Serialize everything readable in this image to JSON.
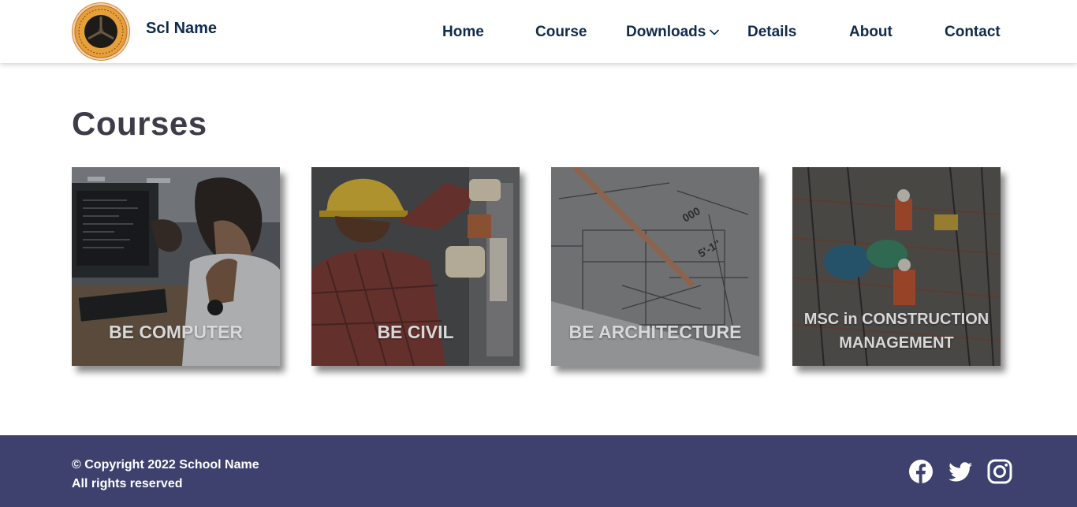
{
  "header": {
    "brand": "Scl Name",
    "logo_icon": "school-crest-logo",
    "nav": [
      {
        "label": "Home"
      },
      {
        "label": "Course"
      },
      {
        "label": "Downloads",
        "icon": "chevron-down-icon"
      },
      {
        "label": "Details"
      },
      {
        "label": "About"
      },
      {
        "label": "Contact"
      }
    ]
  },
  "courses": {
    "title": "Courses",
    "items": [
      {
        "label": "BE COMPUTER",
        "image": "students-at-computers"
      },
      {
        "label": "BE CIVIL",
        "image": "worker-with-hardhat"
      },
      {
        "label": "BE ARCHITECTURE",
        "image": "blueprint-with-pencil"
      },
      {
        "label": "MSC  in CONSTRUCTION MANAGEMENT",
        "image": "construction-site"
      }
    ]
  },
  "footer": {
    "copyright": "© Copyright 2022 School Name",
    "rights": "All rights reserved",
    "social": [
      "facebook-icon",
      "twitter-icon",
      "instagram-icon"
    ]
  },
  "colors": {
    "nav_text": "#0f2a4a",
    "title_text": "#3f3c4a",
    "footer_bg": "#3e416e",
    "card_label": "#d8d8d8"
  }
}
